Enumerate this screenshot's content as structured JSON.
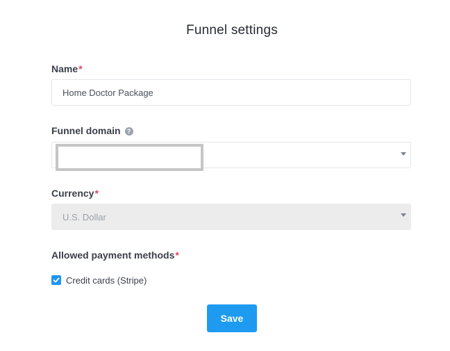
{
  "page": {
    "title": "Funnel settings"
  },
  "form": {
    "name": {
      "label": "Name",
      "required_mark": "*",
      "value": "Home Doctor Package"
    },
    "funnel_domain": {
      "label": "Funnel domain",
      "help_icon": "question-circle-icon",
      "help_glyph": "?",
      "value": ""
    },
    "currency": {
      "label": "Currency",
      "required_mark": "*",
      "value": "U.S. Dollar",
      "disabled": true
    },
    "payment_methods": {
      "label": "Allowed payment methods",
      "required_mark": "*",
      "options": [
        {
          "label": "Credit cards (Stripe)",
          "checked": true
        }
      ]
    },
    "save_label": "Save"
  },
  "colors": {
    "accent": "#1e9bf0",
    "required": "#e2445c",
    "disabled_bg": "#ececec",
    "border": "#e3e6ea"
  }
}
